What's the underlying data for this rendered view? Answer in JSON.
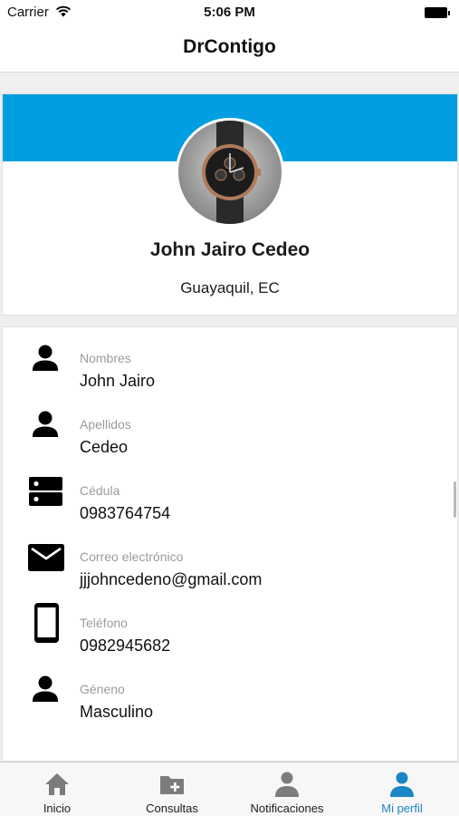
{
  "status_bar": {
    "carrier": "Carrier",
    "time": "5:06 PM"
  },
  "nav": {
    "title": "DrContigo"
  },
  "profile": {
    "name": "John Jairo Cedeo",
    "location": "Guayaquil, EC",
    "banner_color": "#029ee2"
  },
  "details": [
    {
      "icon": "person-icon",
      "label": "Nombres",
      "value": "John Jairo"
    },
    {
      "icon": "person-icon",
      "label": "Apellidos",
      "value": "Cedeo"
    },
    {
      "icon": "id-card-icon",
      "label": "Cédula",
      "value": "0983764754"
    },
    {
      "icon": "mail-icon",
      "label": "Correo electrónico",
      "value": "jjjohncedeno@gmail.com"
    },
    {
      "icon": "phone-icon",
      "label": "Teléfono",
      "value": "0982945682"
    },
    {
      "icon": "person-icon",
      "label": "Géneno",
      "value": "Masculino"
    }
  ],
  "tabs": [
    {
      "icon": "home-icon",
      "label": "Inicio",
      "active": false
    },
    {
      "icon": "folder-plus-icon",
      "label": "Consultas",
      "active": false
    },
    {
      "icon": "person-icon",
      "label": "Notificaciones",
      "active": false
    },
    {
      "icon": "person-icon",
      "label": "Mi perfil",
      "active": true
    }
  ],
  "colors": {
    "accent": "#029ee2",
    "active_tab": "#1a86c6",
    "inactive_tab_icon": "#7c7c7c"
  }
}
